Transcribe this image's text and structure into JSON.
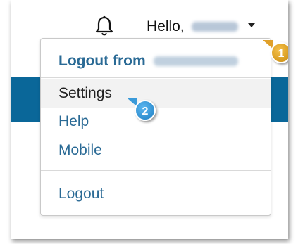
{
  "header": {
    "greeting": "Hello,",
    "user_name_redacted": true
  },
  "dropdown": {
    "header_label": "Logout from",
    "items": [
      {
        "label": "Settings",
        "hovered": true
      },
      {
        "label": "Help"
      },
      {
        "label": "Mobile"
      }
    ],
    "logout_label": "Logout"
  },
  "callouts": [
    {
      "number": "1",
      "color": "#e0a02a"
    },
    {
      "number": "2",
      "color": "#3a9ad9"
    }
  ],
  "icons": {
    "notifications": "bell-icon",
    "menu_toggle": "caret-down-icon"
  },
  "colors": {
    "link": "#2a6a95",
    "band": "#0a6799",
    "hover_bg": "#f2f2f2"
  }
}
